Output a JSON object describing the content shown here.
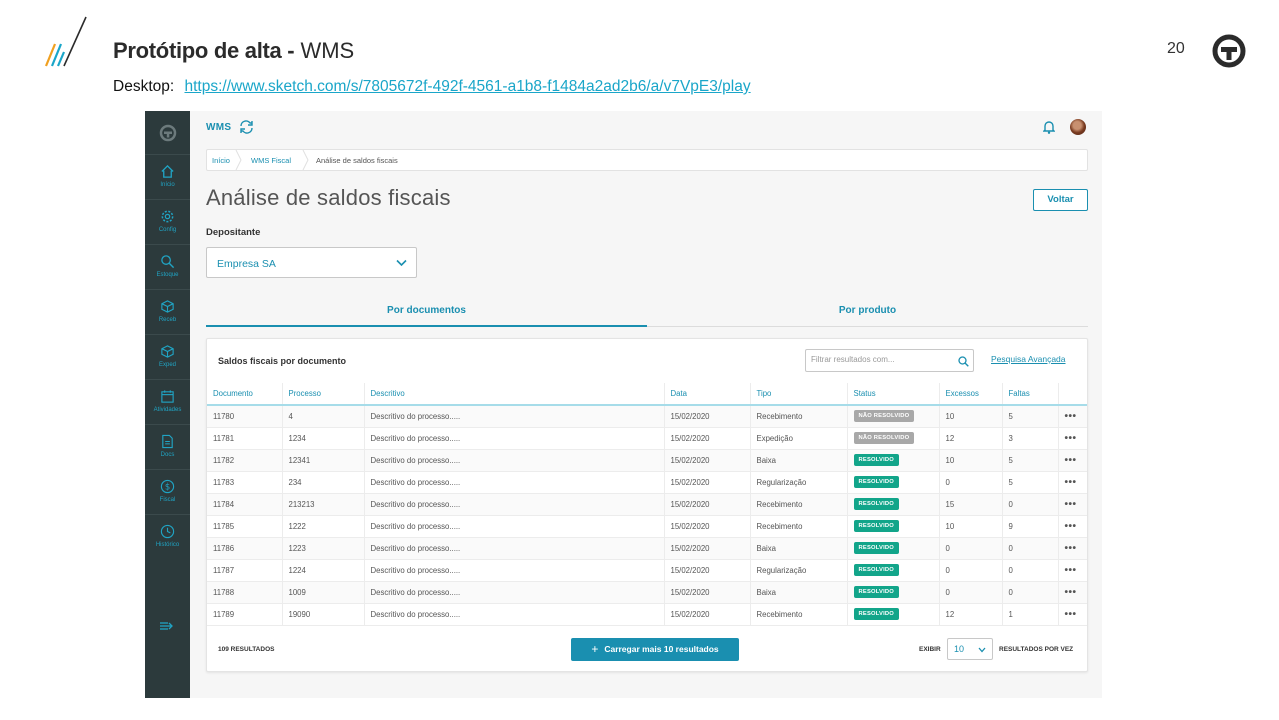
{
  "slide": {
    "title_bold": "Protótipo de alta -",
    "title_light": "WMS",
    "desktop_label": "Desktop:",
    "desktop_url": "https://www.sketch.com/s/7805672f-492f-4561-a1b8-f1484a2ad2b6/a/v7VpE3/play",
    "page_number": "20"
  },
  "colors": {
    "accent": "#1a8fb0",
    "sidebar": "#2c3a3c",
    "resolved": "#12a58a",
    "unresolved": "#a8a8a8"
  },
  "sidebar": {
    "items": [
      {
        "label": "Início",
        "icon": "home-icon"
      },
      {
        "label": "Config",
        "icon": "gear-icon"
      },
      {
        "label": "Estoque",
        "icon": "search-icon"
      },
      {
        "label": "Receb",
        "icon": "box-icon"
      },
      {
        "label": "Exped",
        "icon": "box-icon"
      },
      {
        "label": "Atividades",
        "icon": "calendar-icon"
      },
      {
        "label": "Docs",
        "icon": "document-icon"
      },
      {
        "label": "Fiscal",
        "icon": "dollar-icon"
      },
      {
        "label": "Histórico",
        "icon": "clock-icon"
      }
    ]
  },
  "topbar": {
    "app_name": "WMS"
  },
  "breadcrumb": [
    "Início",
    "WMS Fiscal",
    "Análise de saldos fiscais"
  ],
  "page": {
    "title": "Análise de saldos fiscais",
    "back_label": "Voltar",
    "depositor_label": "Depositante",
    "depositor_value": "Empresa SA"
  },
  "tabs": [
    {
      "label": "Por documentos",
      "active": true
    },
    {
      "label": "Por produto",
      "active": false
    }
  ],
  "table_card": {
    "title": "Saldos fiscais por documento",
    "filter_placeholder": "Filtrar resultados com...",
    "advanced_search": "Pesquisa Avançada",
    "columns": [
      "Documento",
      "Processo",
      "Descritivo",
      "Data",
      "Tipo",
      "Status",
      "Excessos",
      "Faltas"
    ],
    "rows": [
      [
        "11780",
        "4",
        "Descritivo do processo.....",
        "15/02/2020",
        "Recebimento",
        "NÃO RESOLVIDO",
        "10",
        "5"
      ],
      [
        "11781",
        "1234",
        "Descritivo do processo.....",
        "15/02/2020",
        "Expedição",
        "NÃO RESOLVIDO",
        "12",
        "3"
      ],
      [
        "11782",
        "12341",
        "Descritivo do processo.....",
        "15/02/2020",
        "Baixa",
        "RESOLVIDO",
        "10",
        "5"
      ],
      [
        "11783",
        "234",
        "Descritivo do processo.....",
        "15/02/2020",
        "Regularização",
        "RESOLVIDO",
        "0",
        "5"
      ],
      [
        "11784",
        "213213",
        "Descritivo do processo.....",
        "15/02/2020",
        "Recebimento",
        "RESOLVIDO",
        "15",
        "0"
      ],
      [
        "11785",
        "1222",
        "Descritivo do processo.....",
        "15/02/2020",
        "Recebimento",
        "RESOLVIDO",
        "10",
        "9"
      ],
      [
        "11786",
        "1223",
        "Descritivo do processo.....",
        "15/02/2020",
        "Baixa",
        "RESOLVIDO",
        "0",
        "0"
      ],
      [
        "11787",
        "1224",
        "Descritivo do processo.....",
        "15/02/2020",
        "Regularização",
        "RESOLVIDO",
        "0",
        "0"
      ],
      [
        "11788",
        "1009",
        "Descritivo do processo.....",
        "15/02/2020",
        "Baixa",
        "RESOLVIDO",
        "0",
        "0"
      ],
      [
        "11789",
        "19090",
        "Descritivo do processo.....",
        "15/02/2020",
        "Recebimento",
        "RESOLVIDO",
        "12",
        "1"
      ]
    ],
    "more_icon": "•••",
    "results_count": "109 RESULTADOS",
    "load_more": "Carregar mais 10 resultados",
    "show_label": "EXIBIR",
    "per_page_value": "10",
    "per_page_label": "RESULTADOS POR VEZ"
  }
}
